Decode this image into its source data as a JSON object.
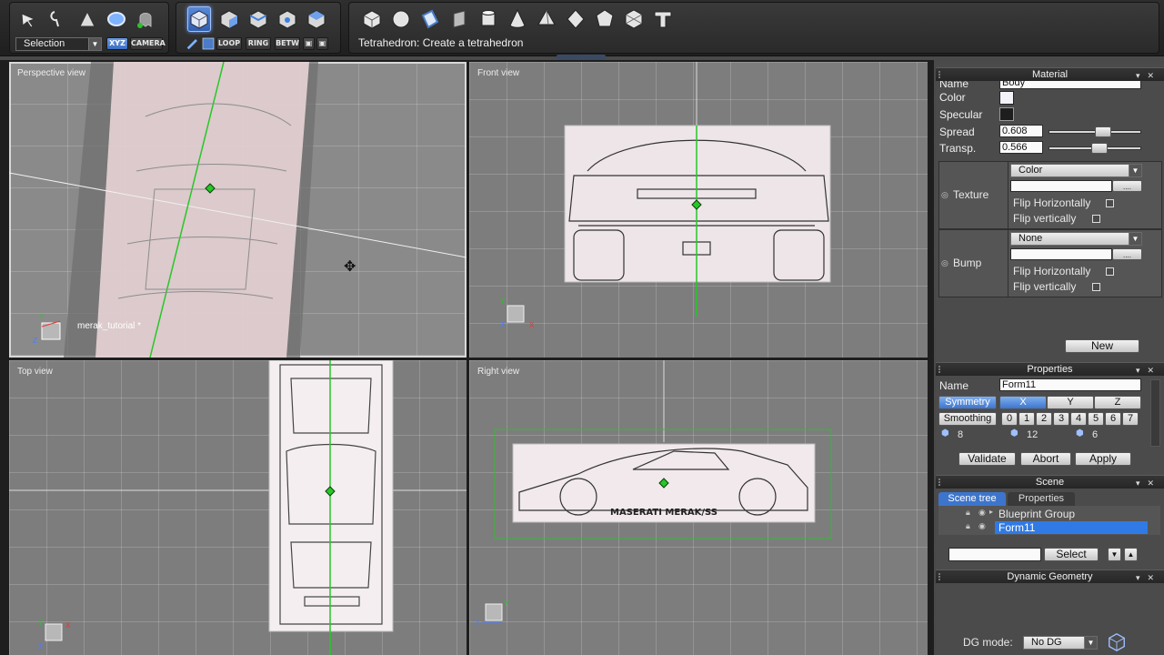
{
  "toolbar": {
    "mode_dropdown": "Selection",
    "axis_buttons": [
      "XYZ",
      "CAMERA"
    ],
    "selection_buttons": [
      "LOOP",
      "RING",
      "BETW"
    ],
    "status": "Tetrahedron: Create a tetrahedron"
  },
  "viewports": {
    "perspective": {
      "label": "Perspective view",
      "object_label": "merak_tutorial *"
    },
    "front": {
      "label": "Front view"
    },
    "top": {
      "label": "Top view"
    },
    "right": {
      "label": "Right view",
      "car_text": "MASERATI MERAK/SS"
    }
  },
  "material": {
    "title": "Material",
    "name_label": "Name",
    "name_value": "Body",
    "color_label": "Color",
    "specular_label": "Specular",
    "spread_label": "Spread",
    "spread_value": "0.608",
    "spread_level": 0.608,
    "transp_label": "Transp.",
    "transp_value": "0.566",
    "transp_level": 0.566,
    "texture_label": "Texture",
    "texture_mode": "Color",
    "bump_label": "Bump",
    "bump_mode": "None",
    "flip_h": "Flip Horizontally",
    "flip_v": "Flip vertically",
    "browse": "....",
    "new_button": "New",
    "color_swatch": "#f2f2f8",
    "specular_swatch": "#1e1e1e"
  },
  "properties": {
    "title": "Properties",
    "name_label": "Name",
    "name_value": "Form11",
    "symmetry_label": "Symmetry",
    "axes": [
      "X",
      "Y",
      "Z"
    ],
    "smoothing_label": "Smoothing",
    "smoothing_levels": [
      "0",
      "1",
      "2",
      "3",
      "4",
      "5",
      "6",
      "7"
    ],
    "counts": [
      "8",
      "12",
      "6"
    ],
    "validate": "Validate",
    "abort": "Abort",
    "apply": "Apply"
  },
  "scene": {
    "title": "Scene",
    "tabs": [
      "Scene tree",
      "Properties"
    ],
    "items": [
      "Blueprint Group",
      "Form11"
    ],
    "select_button": "Select"
  },
  "dynamic_geometry": {
    "title": "Dynamic Geometry",
    "dg_mode_label": "DG mode:",
    "dg_mode_value": "No DG"
  },
  "colors": {
    "accent": "#3d75cc",
    "selection": "#2f7ae5",
    "axis_green": "#27c727"
  }
}
